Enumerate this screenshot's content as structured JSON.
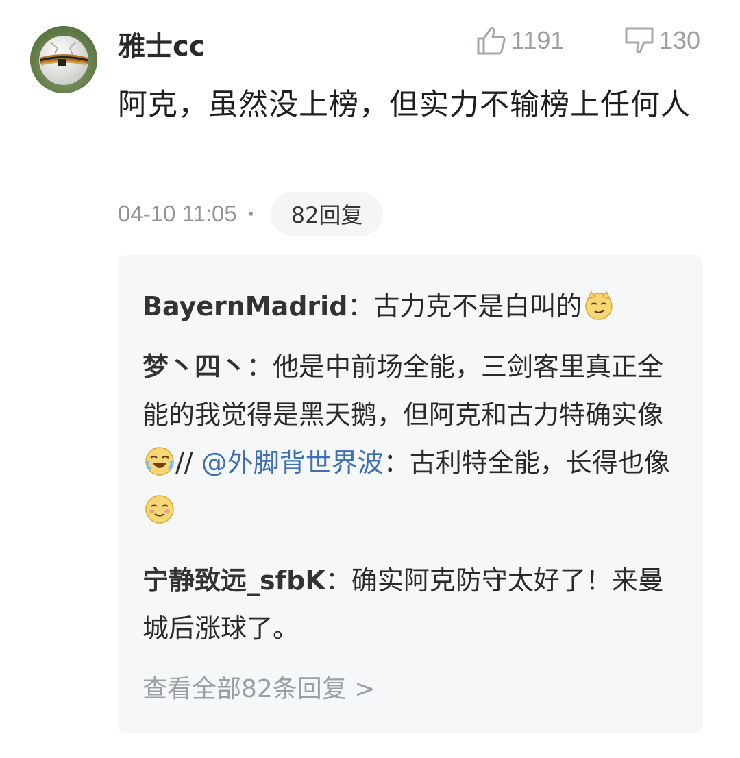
{
  "comment": {
    "username": "雅士cc",
    "likes": "1191",
    "dislikes": "130",
    "text": "阿克，虽然没上榜，但实力不输榜上任何人",
    "timestamp": "04-10 11:05",
    "separator": "·",
    "reply_count_label": "82回复"
  },
  "replies": [
    {
      "name": "BayernMadrid",
      "colon": "：",
      "text": "古力克不是白叫的",
      "emoji": "cat-smirk-emoji"
    },
    {
      "name": "梦丶四丶",
      "colon": "：",
      "text_part1": "他是中前场全能，三剑客里真正全能的我觉得是黑天鹅，但阿克和古力特确实像",
      "emoji1": "crying-laugh-emoji",
      "text_part2": "// ",
      "mention": "@外脚背世界波",
      "text_part3": "：古利特全能，长得也像",
      "emoji2": "smile-emoji"
    },
    {
      "name": "宁静致远_sfbK",
      "colon": "：",
      "text": "确实阿克防守太好了！来曼城后涨球了。"
    }
  ],
  "view_all_label": "查看全部82条回复 >",
  "colors": {
    "mention": "#3d6fb6",
    "muted": "#9a9fa6",
    "reply_bg": "#f6f7f9"
  }
}
